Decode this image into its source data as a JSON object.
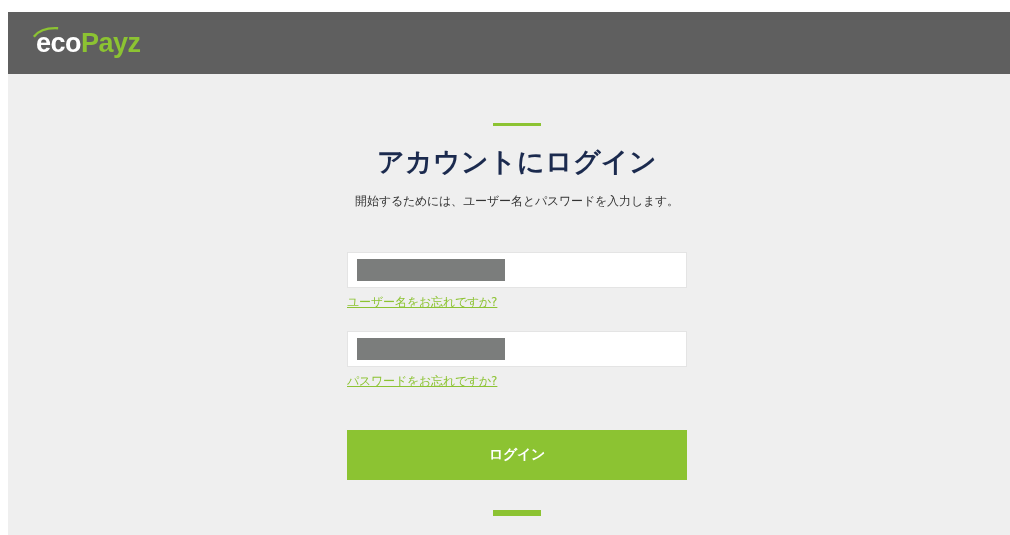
{
  "header": {
    "logo_parts": [
      "eco",
      "Payz"
    ]
  },
  "login": {
    "title": "アカウントにログイン",
    "subtitle": "開始するためには、ユーザー名とパスワードを入力します。",
    "fields": [
      {
        "redacted": true,
        "link": "ユーザー名をお忘れですか?"
      },
      {
        "redacted": true,
        "link": "パスワードをお忘れですか?"
      }
    ],
    "button": "ログイン"
  }
}
